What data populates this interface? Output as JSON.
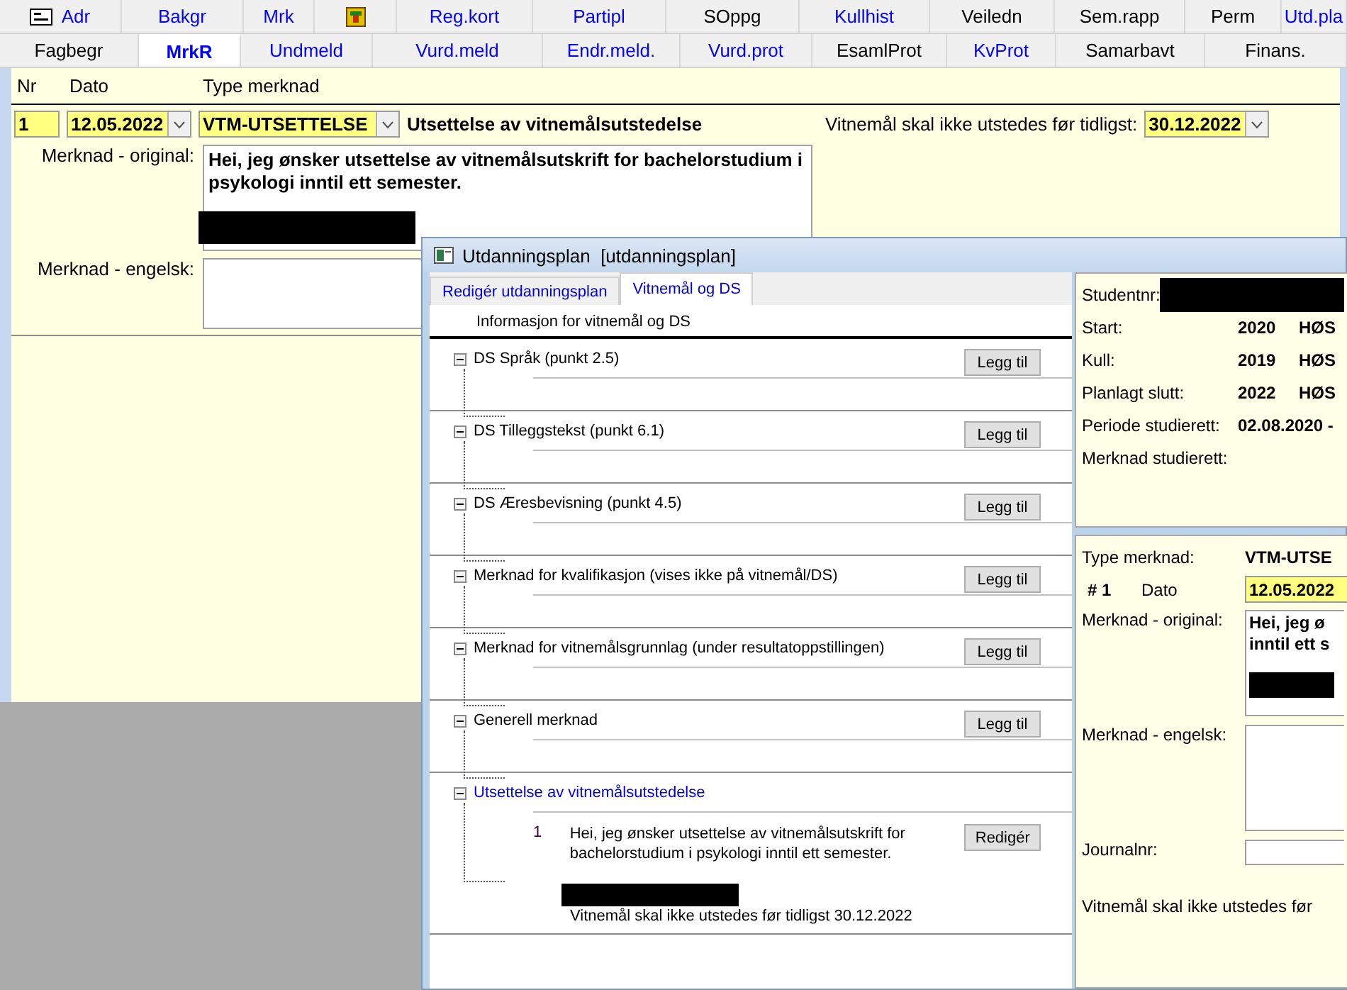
{
  "top_tabs": [
    {
      "kind": "icon_text",
      "label": "Adr",
      "color": "#0000ff"
    },
    {
      "kind": "text",
      "label": "Bakgr",
      "color": "#0000ff"
    },
    {
      "kind": "text",
      "label": "Mrk",
      "color": "#0000ff"
    },
    {
      "kind": "icon"
    },
    {
      "kind": "text",
      "label": "Reg.kort",
      "color": "#0000ff"
    },
    {
      "kind": "text",
      "label": "Partipl",
      "color": "#0000ff"
    },
    {
      "kind": "text",
      "label": "SOppg",
      "color": "#000000"
    },
    {
      "kind": "text",
      "label": "Kullhist",
      "color": "#0000ff"
    },
    {
      "kind": "text",
      "label": "Veiledn",
      "color": "#000000"
    },
    {
      "kind": "text",
      "label": "Sem.rapp",
      "color": "#000000"
    },
    {
      "kind": "text",
      "label": "Perm",
      "color": "#000000"
    },
    {
      "kind": "text",
      "label": "Utd.pla",
      "color": "#0000ff"
    }
  ],
  "sub_tabs": [
    {
      "label": "Fagbegr",
      "color": "#000000",
      "selected": false
    },
    {
      "label": "MrkR",
      "color": "#0000ff",
      "selected": true
    },
    {
      "label": "Undmeld",
      "color": "#0000ff",
      "selected": false
    },
    {
      "label": "Vurd.meld",
      "color": "#0000ff",
      "selected": false
    },
    {
      "label": "Endr.meld.",
      "color": "#0000ff",
      "selected": false
    },
    {
      "label": "Vurd.prot",
      "color": "#0000ff",
      "selected": false
    },
    {
      "label": "EsamlProt",
      "color": "#000000",
      "selected": false
    },
    {
      "label": "KvProt",
      "color": "#0000ff",
      "selected": false
    },
    {
      "label": "Samarbavt",
      "color": "#000000",
      "selected": false
    },
    {
      "label": "Finans.",
      "color": "#000000",
      "selected": false
    }
  ],
  "form": {
    "columns": [
      "Nr",
      "Dato",
      "Type merknad"
    ],
    "nr": "1",
    "dato": "12.05.2022",
    "type": "VTM-UTSETTELSE",
    "type_description": "Utsettelse av vitnemålsutstedelse",
    "deadline_label": "Vitnemål skal ikke utstedes før tidligst:",
    "deadline": "30.12.2022",
    "original_label": "Merknad - original:",
    "original_text": "Hei, jeg ønsker utsettelse av vitnemålsutskrift for bachelorstudium i psykologi inntil ett semester.",
    "english_label": "Merknad - engelsk:"
  },
  "dialog": {
    "title": "Utdanningsplan  [utdanningsplan]",
    "tabs": [
      {
        "label": "Redigér utdanningsplan",
        "selected": false
      },
      {
        "label": "Vitnemål og DS",
        "selected": true
      }
    ],
    "heading": "Informasjon for vitnemål og DS",
    "sections": [
      {
        "title": "DS Språk (punkt 2.5)",
        "expanded": true,
        "highlighted": false,
        "button": "Legg til"
      },
      {
        "title": "DS Tilleggstekst (punkt 6.1)",
        "expanded": true,
        "highlighted": false,
        "button": "Legg til"
      },
      {
        "title": "DS Æresbevisning (punkt 4.5)",
        "expanded": true,
        "highlighted": false,
        "button": "Legg til"
      },
      {
        "title": "Merknad for kvalifikasjon (vises ikke på vitnemål/DS)",
        "expanded": true,
        "highlighted": false,
        "button": "Legg til"
      },
      {
        "title": "Merknad for vitnemålsgrunnlag (under resultatoppstillingen)",
        "expanded": true,
        "highlighted": false,
        "button": "Legg til"
      },
      {
        "title": "Generell merknad",
        "expanded": true,
        "highlighted": false,
        "button": "Legg til"
      },
      {
        "title": "Utsettelse av vitnemålsutstedelse",
        "expanded": true,
        "highlighted": true,
        "entries": [
          {
            "nr": "1",
            "text": "Hei, jeg ønsker utsettelse av vitnemålsutskrift for bachelorstudium i psykologi inntil ett semester.",
            "note": "Vitnemål skal ikke utstedes før tidligst 30.12.2022",
            "button": "Redigér"
          }
        ]
      }
    ],
    "student_panel": {
      "studentnr_label": "Studentnr:",
      "rows": [
        {
          "label": "Start:",
          "year": "2020",
          "term": "HØS"
        },
        {
          "label": "Kull:",
          "year": "2019",
          "term": "HØS"
        },
        {
          "label": "Planlagt slutt:",
          "year": "2022",
          "term": "HØS"
        },
        {
          "label": "Periode studierett:",
          "year": "02.08.2020 -",
          "term": ""
        }
      ],
      "merknad_label": "Merknad studierett:"
    },
    "note_panel": {
      "type_label": "Type merknad:",
      "type": "VTM-UTSE",
      "nr": "# 1",
      "dato_label": "Dato",
      "dato": "12.05.2022",
      "original_label": "Merknad - original:",
      "original_text": "Hei, jeg ø\ninntil ett s",
      "english_label": "Merknad - engelsk:",
      "journal_label": "Journalnr:",
      "deadline_text": "Vitnemål skal ikke utstedes før"
    }
  }
}
